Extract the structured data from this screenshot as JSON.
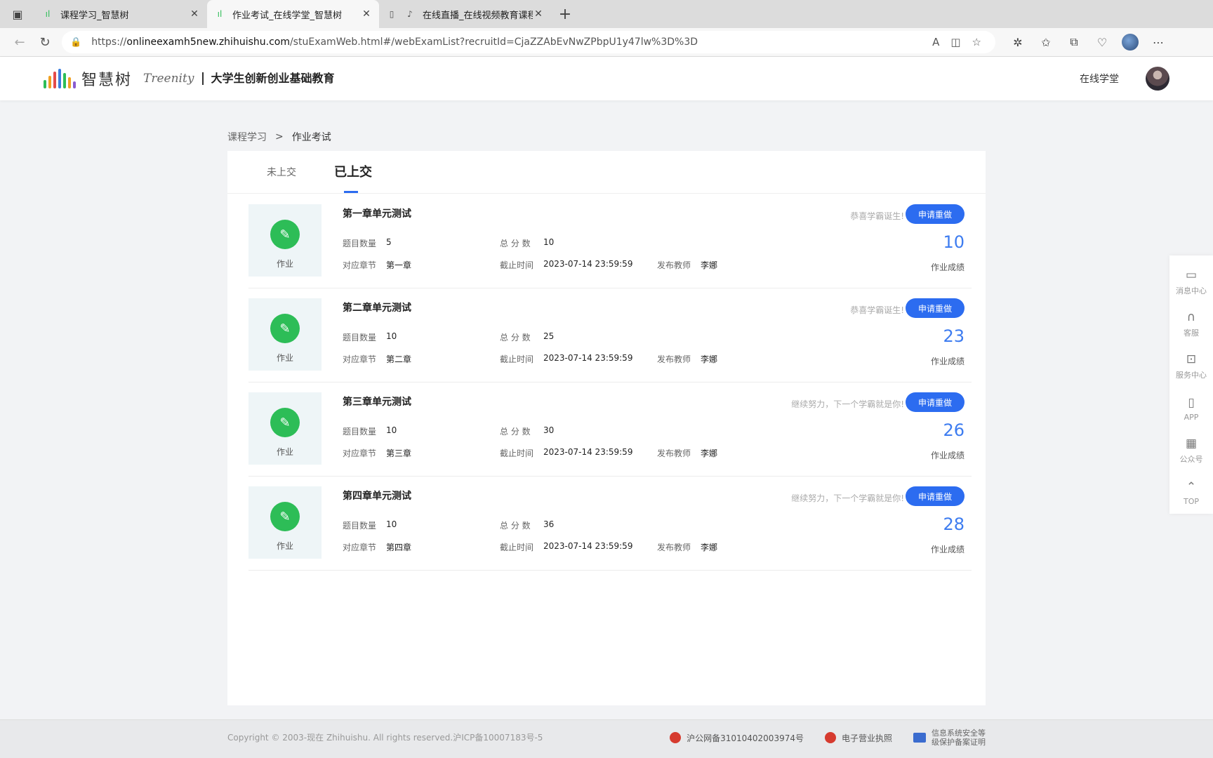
{
  "browser": {
    "tabs": [
      {
        "title": "课程学习_智慧树"
      },
      {
        "title": "作业考试_在线学堂_智慧树"
      },
      {
        "title": "在线直播_在线视频教育课程"
      }
    ],
    "url_prefix": "https://",
    "url_host": "onlineexamh5new.zhihuishu.com",
    "url_path": "/stuExamWeb.html#/webExamList?recruitId=CjaZZAbEvNwZPbpU1y47lw%3D%3D"
  },
  "header": {
    "logo_cn": "智慧树",
    "logo_en": "Treenity",
    "course_title": "大学生创新创业基础教育",
    "link": "在线学堂"
  },
  "breadcrumb": {
    "parent": "课程学习",
    "current": "作业考试"
  },
  "tabs": {
    "pending": "未上交",
    "submitted": "已上交"
  },
  "labels": {
    "badge": "作业",
    "question_count": "题目数量",
    "total_score": "总 分 数",
    "chapter": "对应章节",
    "deadline": "截止时间",
    "teacher": "发布教师",
    "redo": "申请重做",
    "score_label": "作业成绩"
  },
  "assignments": [
    {
      "title": "第一章单元测试",
      "questions": "5",
      "total": "10",
      "chapter": "第一章",
      "deadline": "2023-07-14 23:59:59",
      "teacher": "李娜",
      "note": "恭喜学霸诞生!",
      "score": "10"
    },
    {
      "title": "第二章单元测试",
      "questions": "10",
      "total": "25",
      "chapter": "第二章",
      "deadline": "2023-07-14 23:59:59",
      "teacher": "李娜",
      "note": "恭喜学霸诞生!",
      "score": "23"
    },
    {
      "title": "第三章单元测试",
      "questions": "10",
      "total": "30",
      "chapter": "第三章",
      "deadline": "2023-07-14 23:59:59",
      "teacher": "李娜",
      "note": "继续努力，下一个学霸就是你!",
      "score": "26"
    },
    {
      "title": "第四章单元测试",
      "questions": "10",
      "total": "36",
      "chapter": "第四章",
      "deadline": "2023-07-14 23:59:59",
      "teacher": "李娜",
      "note": "继续努力，下一个学霸就是你!",
      "score": "28"
    }
  ],
  "sidebar": [
    {
      "label": "消息中心",
      "icon": "message-icon"
    },
    {
      "label": "客服",
      "icon": "headset-icon"
    },
    {
      "label": "服务中心",
      "icon": "service-icon"
    },
    {
      "label": "APP",
      "icon": "phone-icon"
    },
    {
      "label": "公众号",
      "icon": "qrcode-icon"
    },
    {
      "label": "TOP",
      "icon": "arrow-up-icon"
    }
  ],
  "footer": {
    "copyright": "Copyright © 2003-现在 Zhihuishu. All rights reserved.沪ICP备10007183号-5",
    "police": "沪公网备31010402003974号",
    "license": "电子营业执照",
    "security_line1": "信息系统安全等",
    "security_line2": "级保护备案证明"
  },
  "colors": {
    "accent": "#2c6cf0",
    "badge_green": "#2dbd57",
    "score_blue": "#3d7cf0"
  }
}
